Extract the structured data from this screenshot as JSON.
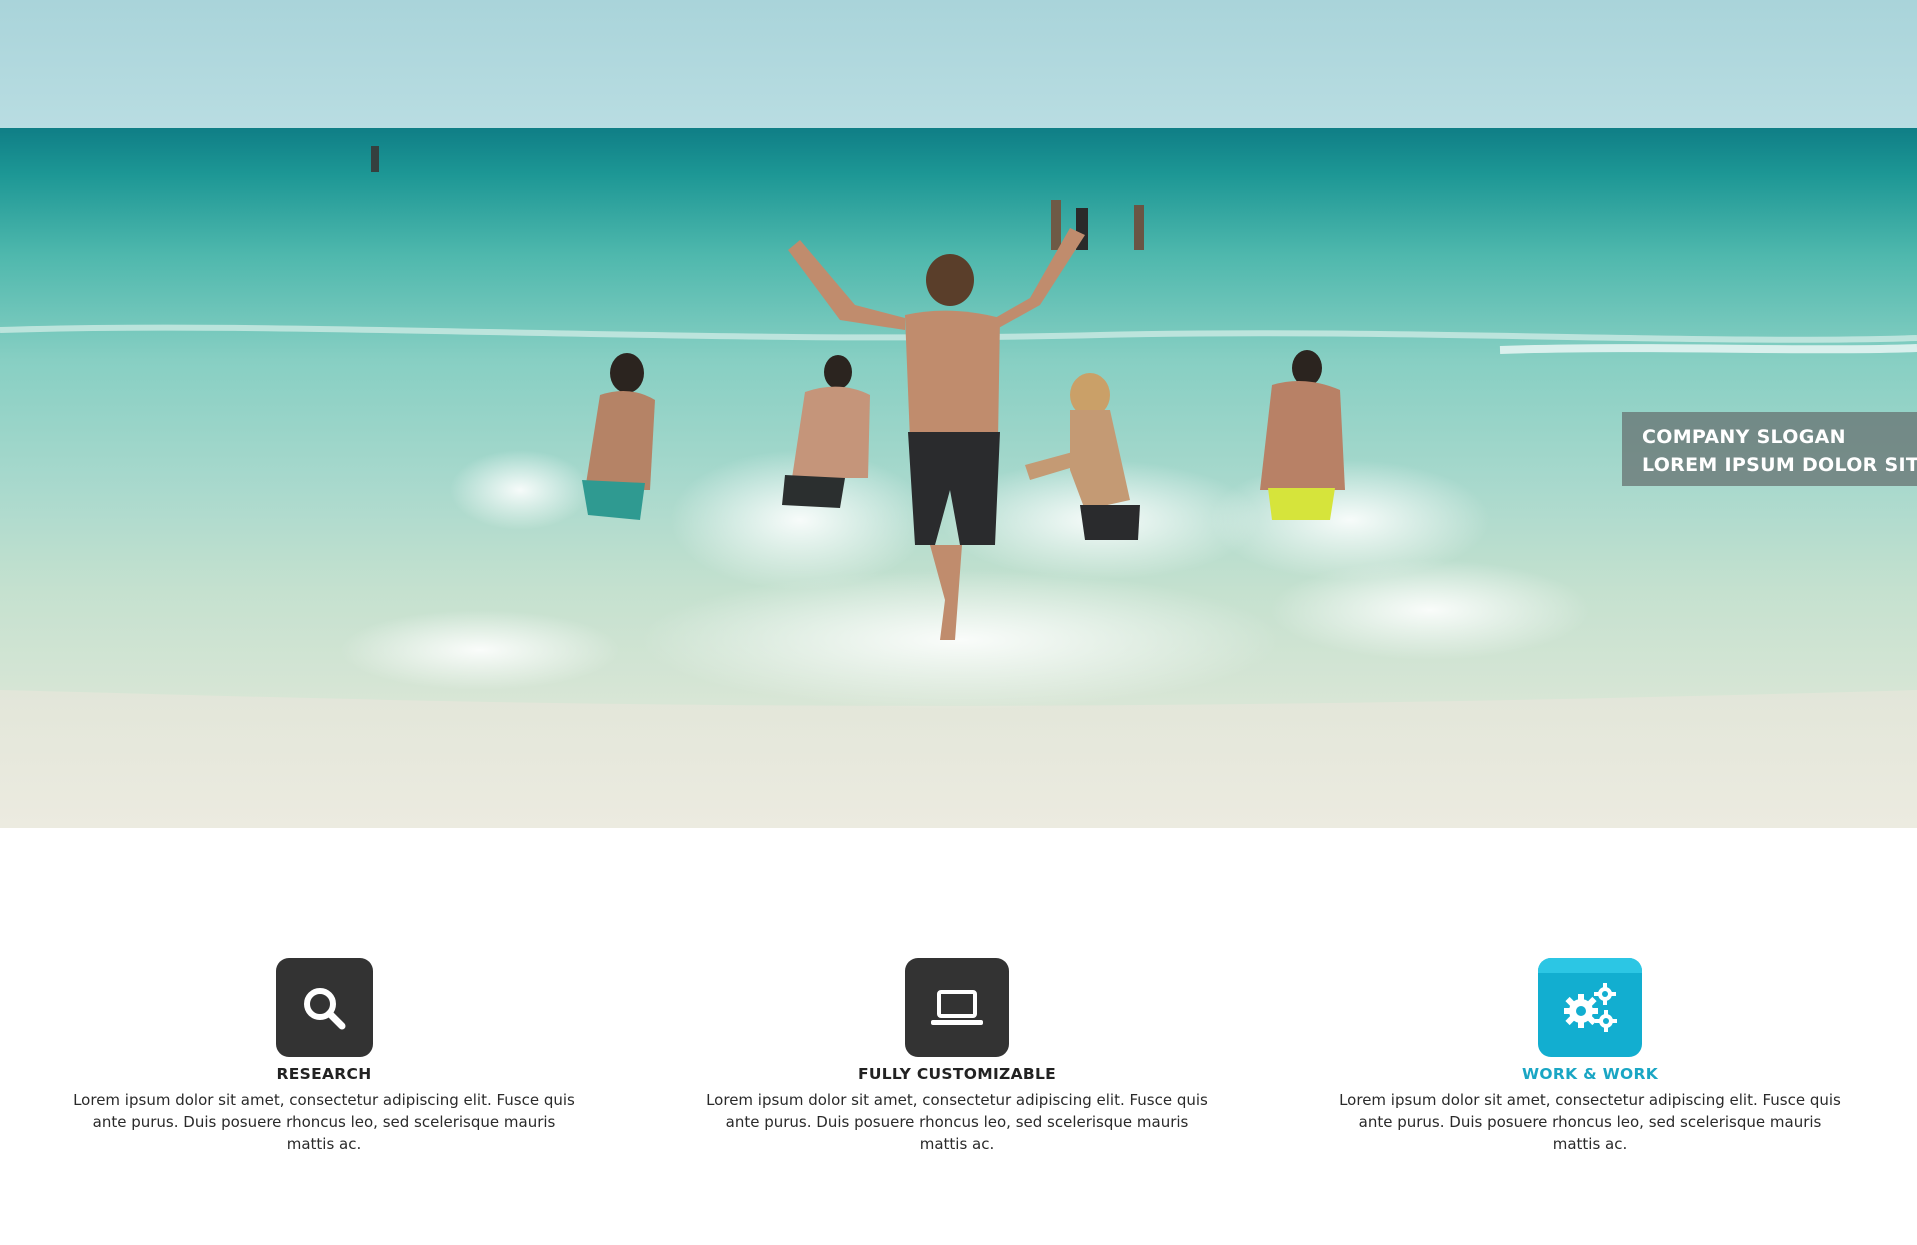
{
  "hero": {
    "slogan_line1": "COMPANY SLOGAN",
    "slogan_line2": "LOREM IPSUM DOLOR SIT"
  },
  "features": [
    {
      "icon": "search-icon",
      "title": "RESEARCH",
      "text": "Lorem ipsum dolor sit amet, consectetur adipiscing elit. Fusce quis ante purus. Duis posuere rhoncus leo, sed scelerisque mauris mattis ac."
    },
    {
      "icon": "laptop-icon",
      "title": "FULLY CUSTOMIZABLE",
      "text": "Lorem ipsum dolor sit amet, consectetur adipiscing elit. Fusce quis ante purus. Duis posuere rhoncus leo, sed scelerisque mauris mattis ac."
    },
    {
      "icon": "gears-icon",
      "title": "WORK & WORK",
      "text": "Lorem ipsum dolor sit amet, consectetur adipiscing elit. Fusce quis ante purus. Duis posuere rhoncus leo, sed scelerisque mauris mattis ac."
    }
  ],
  "colors": {
    "icon_dark": "#333333",
    "icon_accent": "#12aed0",
    "title_accent": "#1aa6c4"
  }
}
